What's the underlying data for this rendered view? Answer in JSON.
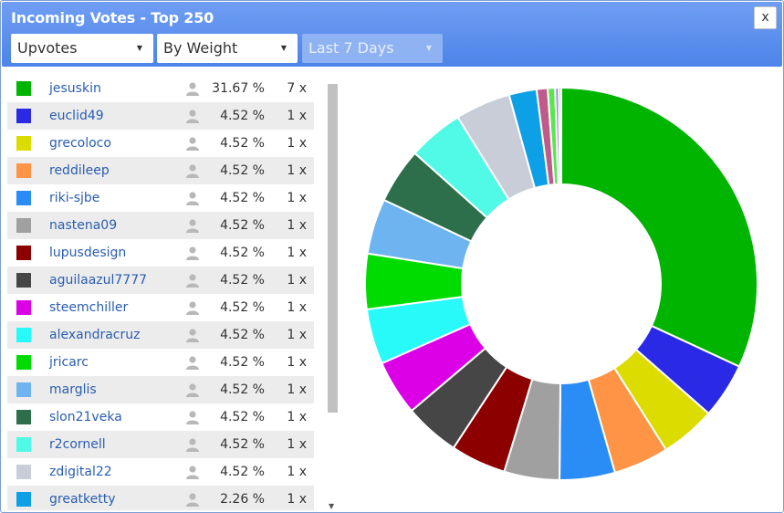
{
  "window": {
    "title": "Incoming Votes - Top 250",
    "close_label": "x"
  },
  "filters": {
    "vote_type": "Upvotes",
    "sort": "By Weight",
    "period": "Last 7 Days"
  },
  "rows": [
    {
      "name": "jesuskin",
      "pct": "31.67 %",
      "count": "7 x",
      "color": "#00b400"
    },
    {
      "name": "euclid49",
      "pct": "4.52 %",
      "count": "1 x",
      "color": "#2a2ae6"
    },
    {
      "name": "grecoloco",
      "pct": "4.52 %",
      "count": "1 x",
      "color": "#dcdc00"
    },
    {
      "name": "reddileep",
      "pct": "4.52 %",
      "count": "1 x",
      "color": "#ff9446"
    },
    {
      "name": "riki-sjbe",
      "pct": "4.52 %",
      "count": "1 x",
      "color": "#2a8cf5"
    },
    {
      "name": "nastena09",
      "pct": "4.52 %",
      "count": "1 x",
      "color": "#a0a0a0"
    },
    {
      "name": "lupusdesign",
      "pct": "4.52 %",
      "count": "1 x",
      "color": "#8c0000"
    },
    {
      "name": "aguilaazul7777",
      "pct": "4.52 %",
      "count": "1 x",
      "color": "#464646"
    },
    {
      "name": "steemchiller",
      "pct": "4.52 %",
      "count": "1 x",
      "color": "#dc00e6"
    },
    {
      "name": "alexandracruz",
      "pct": "4.52 %",
      "count": "1 x",
      "color": "#28fafa"
    },
    {
      "name": "jricarc",
      "pct": "4.52 %",
      "count": "1 x",
      "color": "#00dc00"
    },
    {
      "name": "marglis",
      "pct": "4.52 %",
      "count": "1 x",
      "color": "#6eb4f0"
    },
    {
      "name": "slon21veka",
      "pct": "4.52 %",
      "count": "1 x",
      "color": "#2d6e4b"
    },
    {
      "name": "r2cornell",
      "pct": "4.52 %",
      "count": "1 x",
      "color": "#50fae6"
    },
    {
      "name": "zdigital22",
      "pct": "4.52 %",
      "count": "1 x",
      "color": "#c8cdd7"
    },
    {
      "name": "greatketty",
      "pct": "2.26 %",
      "count": "1 x",
      "color": "#0ea0e6"
    }
  ],
  "chart_data": {
    "type": "pie",
    "values": [
      31.67,
      4.52,
      4.52,
      4.52,
      4.52,
      4.52,
      4.52,
      4.52,
      4.52,
      4.52,
      4.52,
      4.52,
      4.52,
      4.52,
      4.52,
      2.26,
      0.9,
      0.6,
      0.3,
      0.2
    ],
    "colors": [
      "#00b400",
      "#2a2ae6",
      "#dcdc00",
      "#ff9446",
      "#2a8cf5",
      "#a0a0a0",
      "#8c0000",
      "#464646",
      "#dc00e6",
      "#28fafa",
      "#00dc00",
      "#6eb4f0",
      "#2d6e4b",
      "#50fae6",
      "#c8cdd7",
      "#0ea0e6",
      "#c05a8a",
      "#5ae650",
      "#9b8fd0",
      "#b4b4b4"
    ]
  }
}
